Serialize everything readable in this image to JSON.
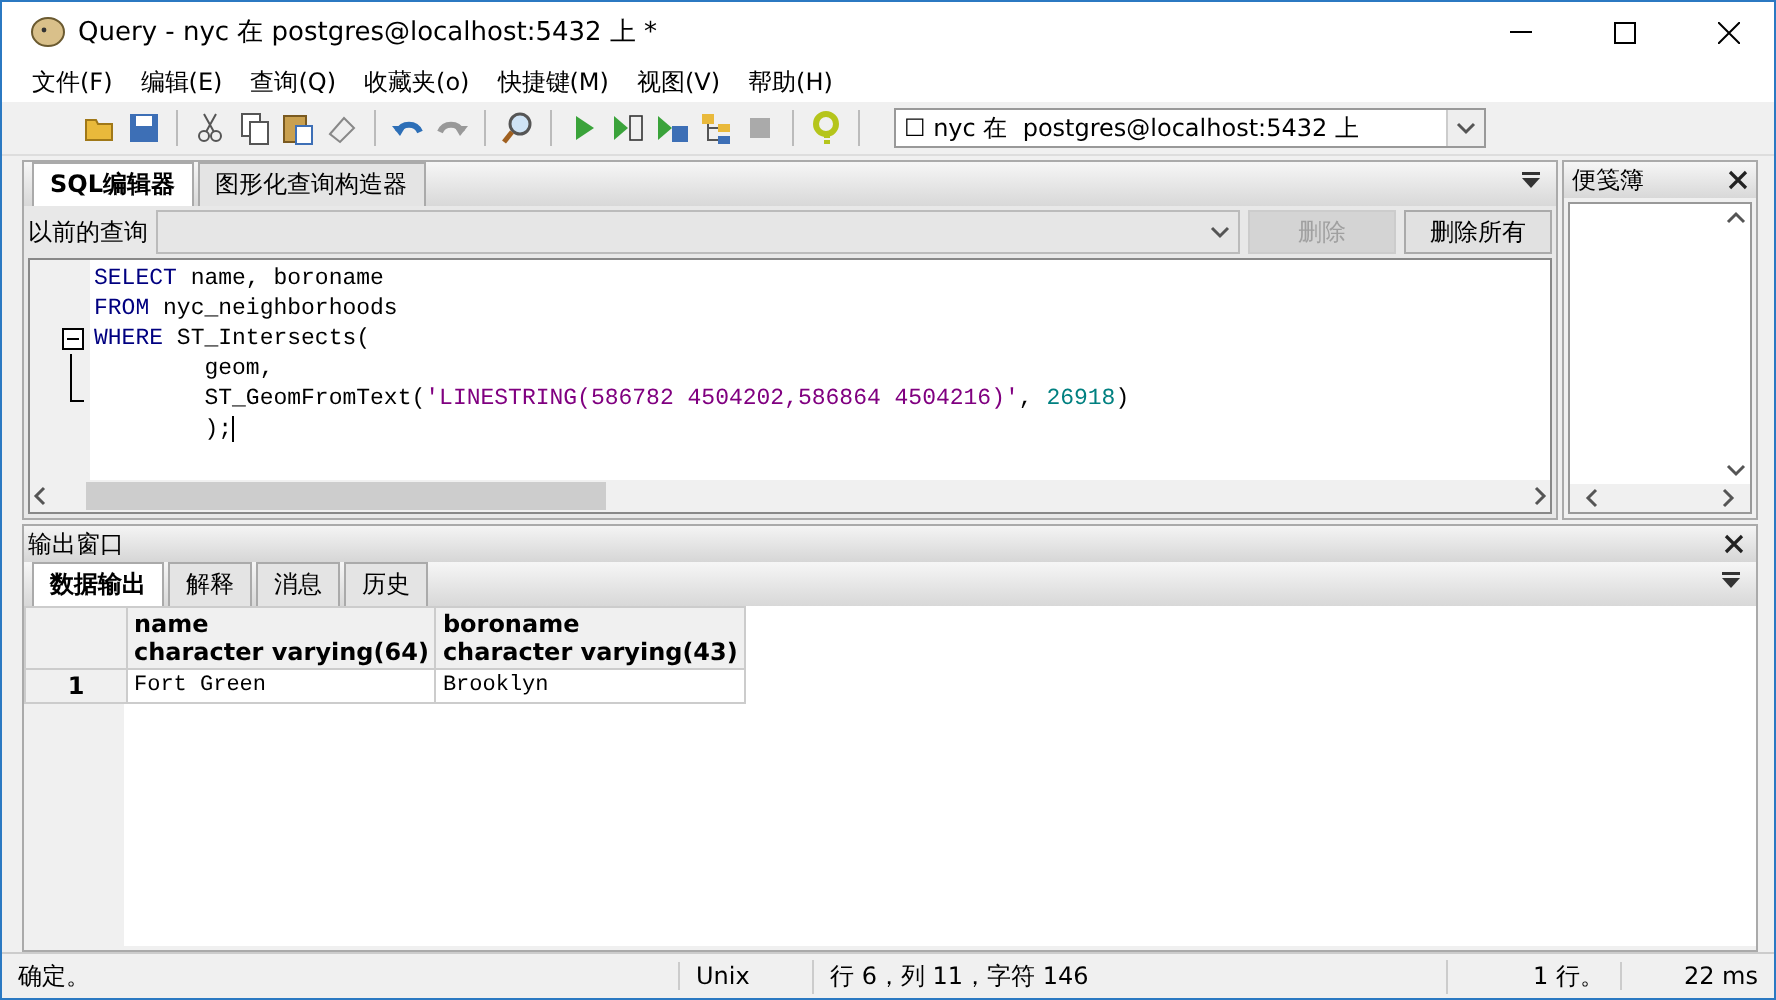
{
  "window": {
    "title": "Query - nyc 在  postgres@localhost:5432 上 *"
  },
  "menu": [
    "文件(F)",
    "编辑(E)",
    "查询(Q)",
    "收藏夹(o)",
    "快捷键(M)",
    "视图(V)",
    "帮助(H)"
  ],
  "connection": {
    "value": "☐ nyc 在  postgres@localhost:5432 上"
  },
  "editor_tabs": [
    {
      "label": "SQL编辑器",
      "selected": true
    },
    {
      "label": "图形化查询构造器",
      "selected": false
    }
  ],
  "previous_queries": {
    "label": "以前的查询",
    "buttons": [
      {
        "label": "删除",
        "disabled": true
      },
      {
        "label": "删除所有",
        "disabled": false
      }
    ]
  },
  "code_lines": [
    {
      "fold_toggle": false,
      "fold_body": false,
      "fold_end": false,
      "caret": false,
      "segments": [
        {
          "kind": "keyword",
          "text": "SELECT"
        },
        {
          "kind": "plain",
          "text": " name, boroname"
        }
      ]
    },
    {
      "fold_toggle": false,
      "fold_body": false,
      "fold_end": false,
      "caret": false,
      "segments": [
        {
          "kind": "keyword",
          "text": "FROM"
        },
        {
          "kind": "plain",
          "text": " nyc_neighborhoods"
        }
      ]
    },
    {
      "fold_toggle": true,
      "fold_body": false,
      "fold_end": false,
      "caret": false,
      "segments": [
        {
          "kind": "keyword",
          "text": "WHERE"
        },
        {
          "kind": "plain",
          "text": " ST_Intersects("
        }
      ]
    },
    {
      "fold_toggle": false,
      "fold_body": true,
      "fold_end": false,
      "caret": false,
      "segments": [
        {
          "kind": "plain",
          "text": "        geom,"
        }
      ]
    },
    {
      "fold_toggle": false,
      "fold_body": false,
      "fold_end": true,
      "caret": false,
      "segments": [
        {
          "kind": "plain",
          "text": "        ST_GeomFromText("
        },
        {
          "kind": "string",
          "text": "'LINESTRING(586782 4504202,586864 4504216)'"
        },
        {
          "kind": "plain",
          "text": ", "
        },
        {
          "kind": "number",
          "text": "26918"
        },
        {
          "kind": "plain",
          "text": ")"
        }
      ]
    },
    {
      "fold_toggle": false,
      "fold_body": false,
      "fold_end": false,
      "caret": true,
      "segments": [
        {
          "kind": "plain",
          "text": "        );"
        }
      ]
    }
  ],
  "notepad": {
    "title": "便笺簿"
  },
  "output": {
    "title": "输出窗口",
    "tabs": [
      {
        "label": "数据输出",
        "selected": true
      },
      {
        "label": "解释",
        "selected": false
      },
      {
        "label": "消息",
        "selected": false
      },
      {
        "label": "历史",
        "selected": false
      }
    ],
    "columns": [
      {
        "name": "name",
        "type": "character varying(64)"
      },
      {
        "name": "boroname",
        "type": "character varying(43)"
      }
    ],
    "rows": [
      {
        "number": "1",
        "cells": [
          "Fort Green",
          "Brooklyn"
        ]
      }
    ]
  },
  "status_bar": {
    "message": "确定。",
    "line_ending": "Unix",
    "position": "行 6，列 11，字符 146",
    "rows": "1 行。",
    "time": "22 ms"
  }
}
